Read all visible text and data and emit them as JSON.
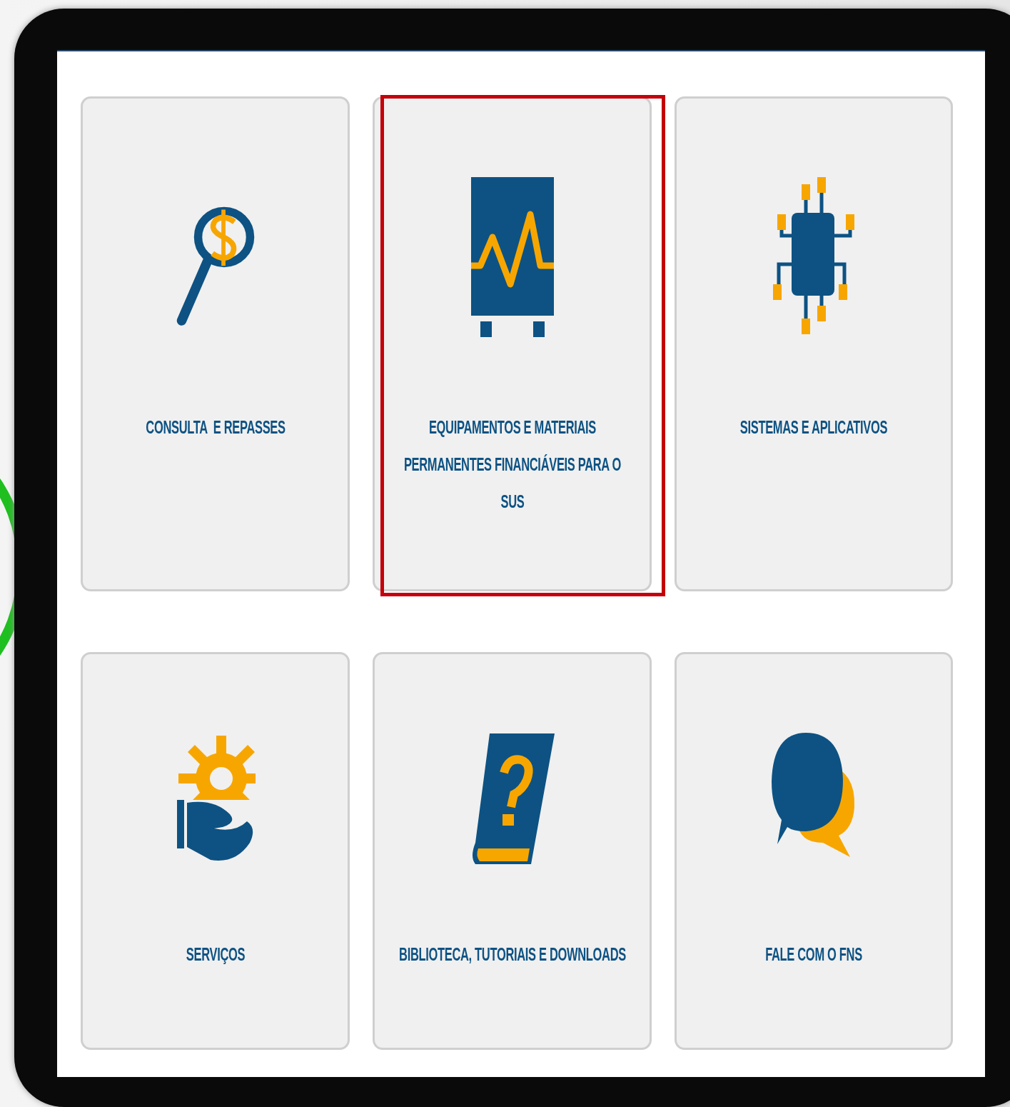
{
  "cards": [
    {
      "kind": "finance",
      "label": "CONSULTA  E REPASSES",
      "highlighted": false
    },
    {
      "kind": "equipment",
      "label": "EQUIPAMENTOS E MATERIAIS PERMANENTES FINANCIÁVEIS PARA O SUS",
      "highlighted": true
    },
    {
      "kind": "systems",
      "label": "SISTEMAS E APLICATIVOS",
      "highlighted": false
    },
    {
      "kind": "services",
      "label": "SERVIÇOS",
      "highlighted": false
    },
    {
      "kind": "library",
      "label": "BIBLIOTECA, TUTORIAIS E DOWNLOADS",
      "highlighted": false
    },
    {
      "kind": "contact",
      "label": "FALE COM O FNS",
      "highlighted": false
    }
  ]
}
